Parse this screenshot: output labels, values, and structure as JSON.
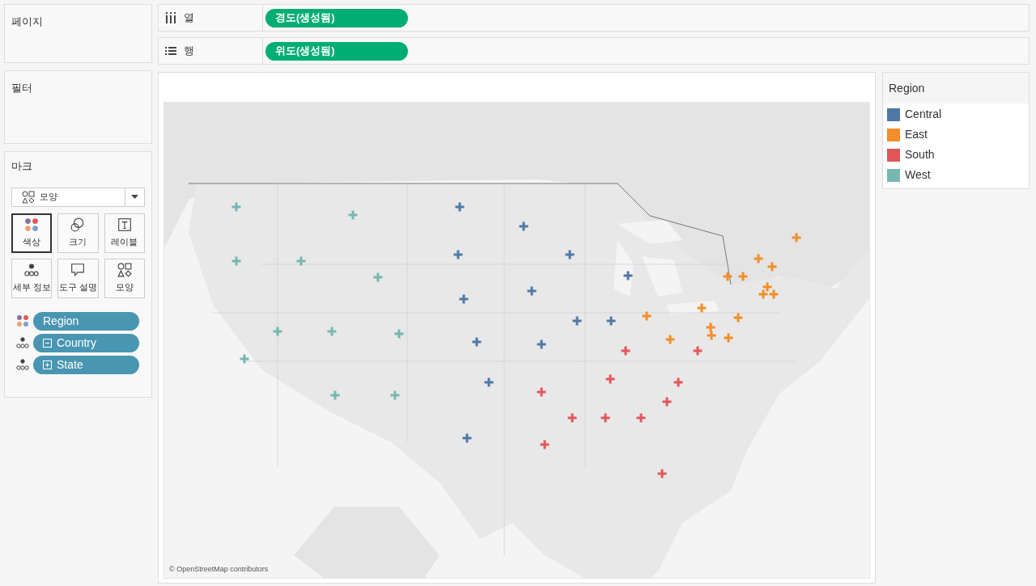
{
  "pages_panel": {
    "title": "페이지"
  },
  "shelves": [
    {
      "kind": "columns",
      "label": "열",
      "pill": "경도(생성됨)"
    },
    {
      "kind": "rows",
      "label": "행",
      "pill": "위도(생성됨)"
    }
  ],
  "filters_panel": {
    "title": "필터"
  },
  "marks_panel": {
    "title": "마크",
    "mark_type": "모양",
    "cards": [
      {
        "kind": "color",
        "label": "색상",
        "selected": true
      },
      {
        "kind": "size",
        "label": "크기",
        "selected": false
      },
      {
        "kind": "label",
        "label": "레이블",
        "selected": false
      },
      {
        "kind": "detail",
        "label": "세부 정보",
        "selected": false
      },
      {
        "kind": "tooltip",
        "label": "도구 설명",
        "selected": false
      },
      {
        "kind": "shape",
        "label": "모양",
        "selected": false
      }
    ],
    "fields": [
      {
        "kind": "color",
        "label": "Region"
      },
      {
        "kind": "detail",
        "label": "Country",
        "expanded": true
      },
      {
        "kind": "detail",
        "label": "State",
        "expanded": false
      }
    ]
  },
  "map": {
    "kind": "picture",
    "attribution": "© OpenStreetMap contributors"
  },
  "legend": {
    "title": "Region",
    "items": [
      {
        "label": "Central",
        "color": "#4e79a7"
      },
      {
        "label": "East",
        "color": "#f28e2b"
      },
      {
        "label": "South",
        "color": "#e15759"
      },
      {
        "label": "West",
        "color": "#76b7b2"
      }
    ]
  }
}
